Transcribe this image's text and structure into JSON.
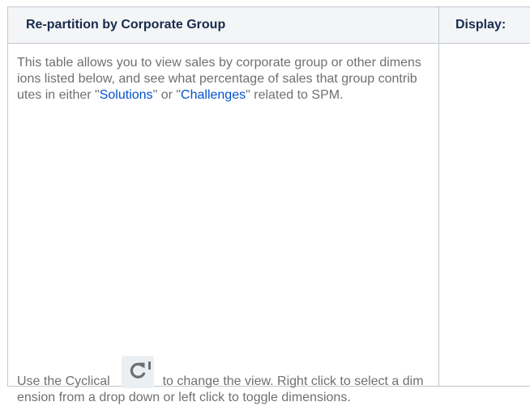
{
  "table": {
    "header_main": "Re-partition by Corporate Group",
    "header_display": "Display:"
  },
  "description": {
    "part1": "This table allows you to view sales by corporate group or other dimensions listed below, and see what percentage of sales that group contributes in either \"",
    "link_solutions": "Solutions",
    "part2": "\" or \"",
    "link_challenges": "Challenges",
    "part3": "\" related to SPM."
  },
  "instructions": {
    "prefix": "Use the Cyclical",
    "icon": "cyclical-refresh-icon",
    "suffix_line1": "to change the view. Right click to",
    "suffix_rest": "select a dimension from a drop down or left click to toggle dimensions."
  },
  "colors": {
    "header_bg": "#f4f5f7",
    "border": "#c1c7d0",
    "body_text": "#707070",
    "link": "#0052cc",
    "header_text": "#172b4d"
  }
}
